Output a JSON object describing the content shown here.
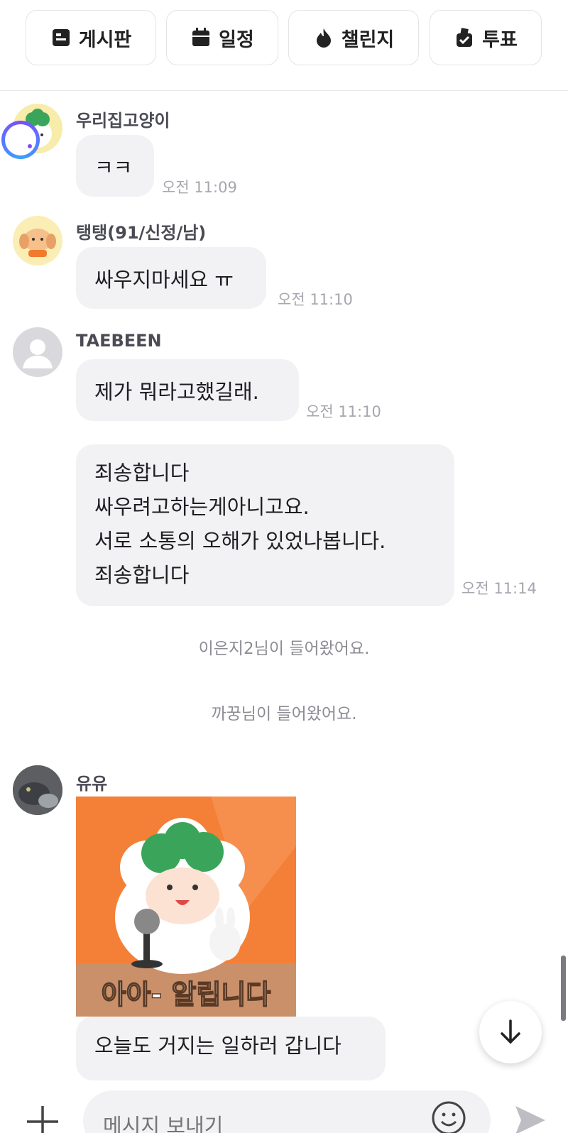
{
  "tabs": [
    {
      "label": "게시판",
      "icon": "board-icon"
    },
    {
      "label": "일정",
      "icon": "calendar-icon"
    },
    {
      "label": "챌린지",
      "icon": "flame-icon"
    },
    {
      "label": "투표",
      "icon": "vote-box-icon"
    }
  ],
  "messages": [
    {
      "sender": "우리집고양이",
      "text": "ㅋㅋ",
      "time": "오전 11:09"
    },
    {
      "sender": "탱탱(91/신정/남)",
      "text": "싸우지마세요 ㅠ",
      "time": "오전 11:10"
    },
    {
      "sender": "TAEBEEN",
      "text": "제가 뭐라고했길래.",
      "time": "오전 11:10"
    },
    {
      "lines": [
        "죄송합니다",
        "싸우려고하는게아니고요.",
        "서로 소통의 오해가 있었나봅니다.",
        "죄송합니다"
      ],
      "time": "오전 11:14"
    },
    {
      "sender": "유유",
      "sticker_text": "아아- 알립니다",
      "text": "오늘도 거지는 일하러 갑니다"
    }
  ],
  "system": [
    "이은지2님이 들어왔어요.",
    "까꿍님이 들어왔어요."
  ],
  "composer": {
    "placeholder": "메시지 보내기"
  },
  "colors": {
    "bubble": "#f2f2f4",
    "sticker_bg": "#f47f37",
    "sticker_floor": "#c9906a",
    "leaf": "#3aa55a"
  }
}
